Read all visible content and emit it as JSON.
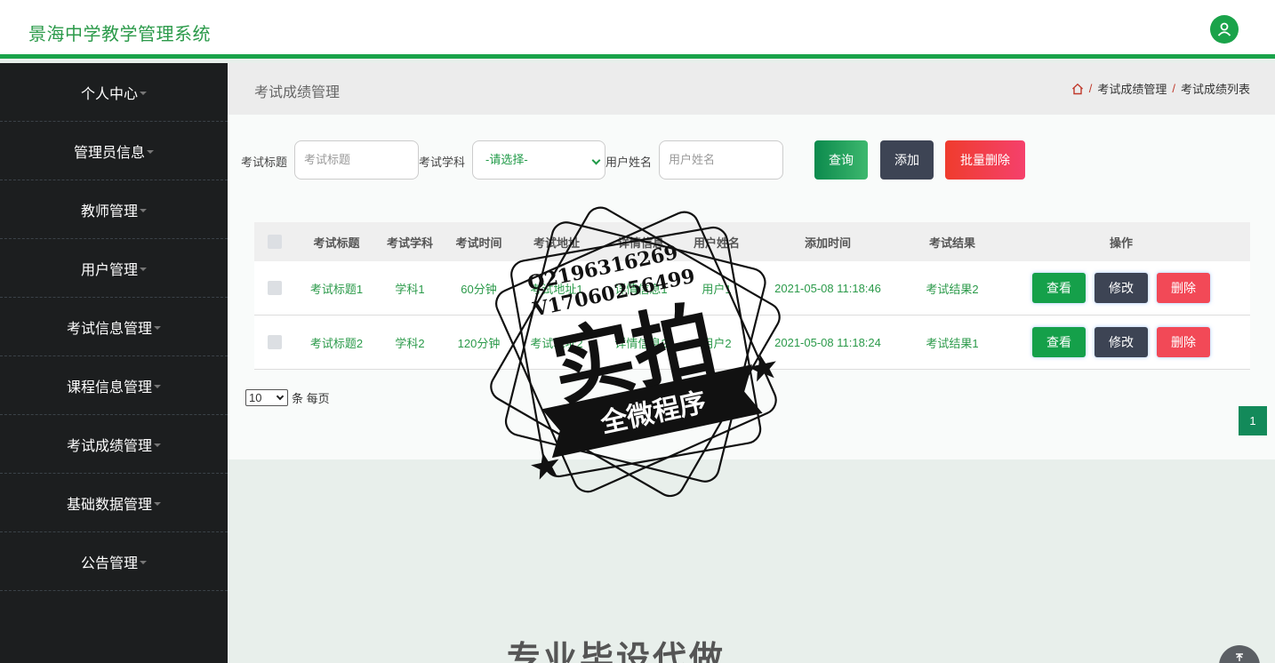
{
  "app": {
    "title": "景海中学教学管理系统"
  },
  "sidebar": {
    "items": [
      {
        "label": "个人中心"
      },
      {
        "label": "管理员信息"
      },
      {
        "label": "教师管理"
      },
      {
        "label": "用户管理"
      },
      {
        "label": "考试信息管理"
      },
      {
        "label": "课程信息管理"
      },
      {
        "label": "考试成绩管理"
      },
      {
        "label": "基础数据管理"
      },
      {
        "label": "公告管理"
      }
    ]
  },
  "header": {
    "page_title": "考试成绩管理",
    "breadcrumb": [
      "考试成绩管理",
      "考试成绩列表"
    ]
  },
  "search": {
    "title_label": "考试标题",
    "title_placeholder": "考试标题",
    "subject_label": "考试学科",
    "subject_value": "-请选择-",
    "username_label": "用户姓名",
    "username_placeholder": "用户姓名",
    "query_button": "查询",
    "add_button": "添加",
    "batch_delete_button": "批量删除"
  },
  "table": {
    "columns": [
      "考试标题",
      "考试学科",
      "考试时间",
      "考试地址",
      "详情信息",
      "用户姓名",
      "添加时间",
      "考试结果",
      "操作"
    ],
    "rows": [
      {
        "title": "考试标题1",
        "subject": "学科1",
        "duration": "60分钟",
        "address": "考试地址1",
        "detail": "详情信息1",
        "user": "用户1",
        "added": "2021-05-08 11:18:46",
        "result": "考试结果2"
      },
      {
        "title": "考试标题2",
        "subject": "学科2",
        "duration": "120分钟",
        "address": "考试地址2",
        "detail": "详情信息2",
        "user": "用户2",
        "added": "2021-05-08 11:18:24",
        "result": "考试结果1"
      }
    ],
    "actions": {
      "view": "查看",
      "edit": "修改",
      "delete": "删除"
    }
  },
  "pagination": {
    "page_size": "10",
    "page_size_suffix": "条 每页",
    "current_page": "1"
  },
  "watermark": {
    "contact_q": "Q2196316269",
    "contact_v": "V17060256499",
    "main": "实拍",
    "banner": "全微程序"
  },
  "background_text": "专业毕设代做",
  "colors": {
    "brand_green": "#1aa34a",
    "sidebar_bg": "#1c1e1f",
    "danger": "#f24957",
    "dark_button": "#3d4454"
  },
  "icons": {
    "avatar": "user-icon",
    "breadcrumb_home": "home-icon",
    "scroll_top": "arrow-up-icon"
  }
}
